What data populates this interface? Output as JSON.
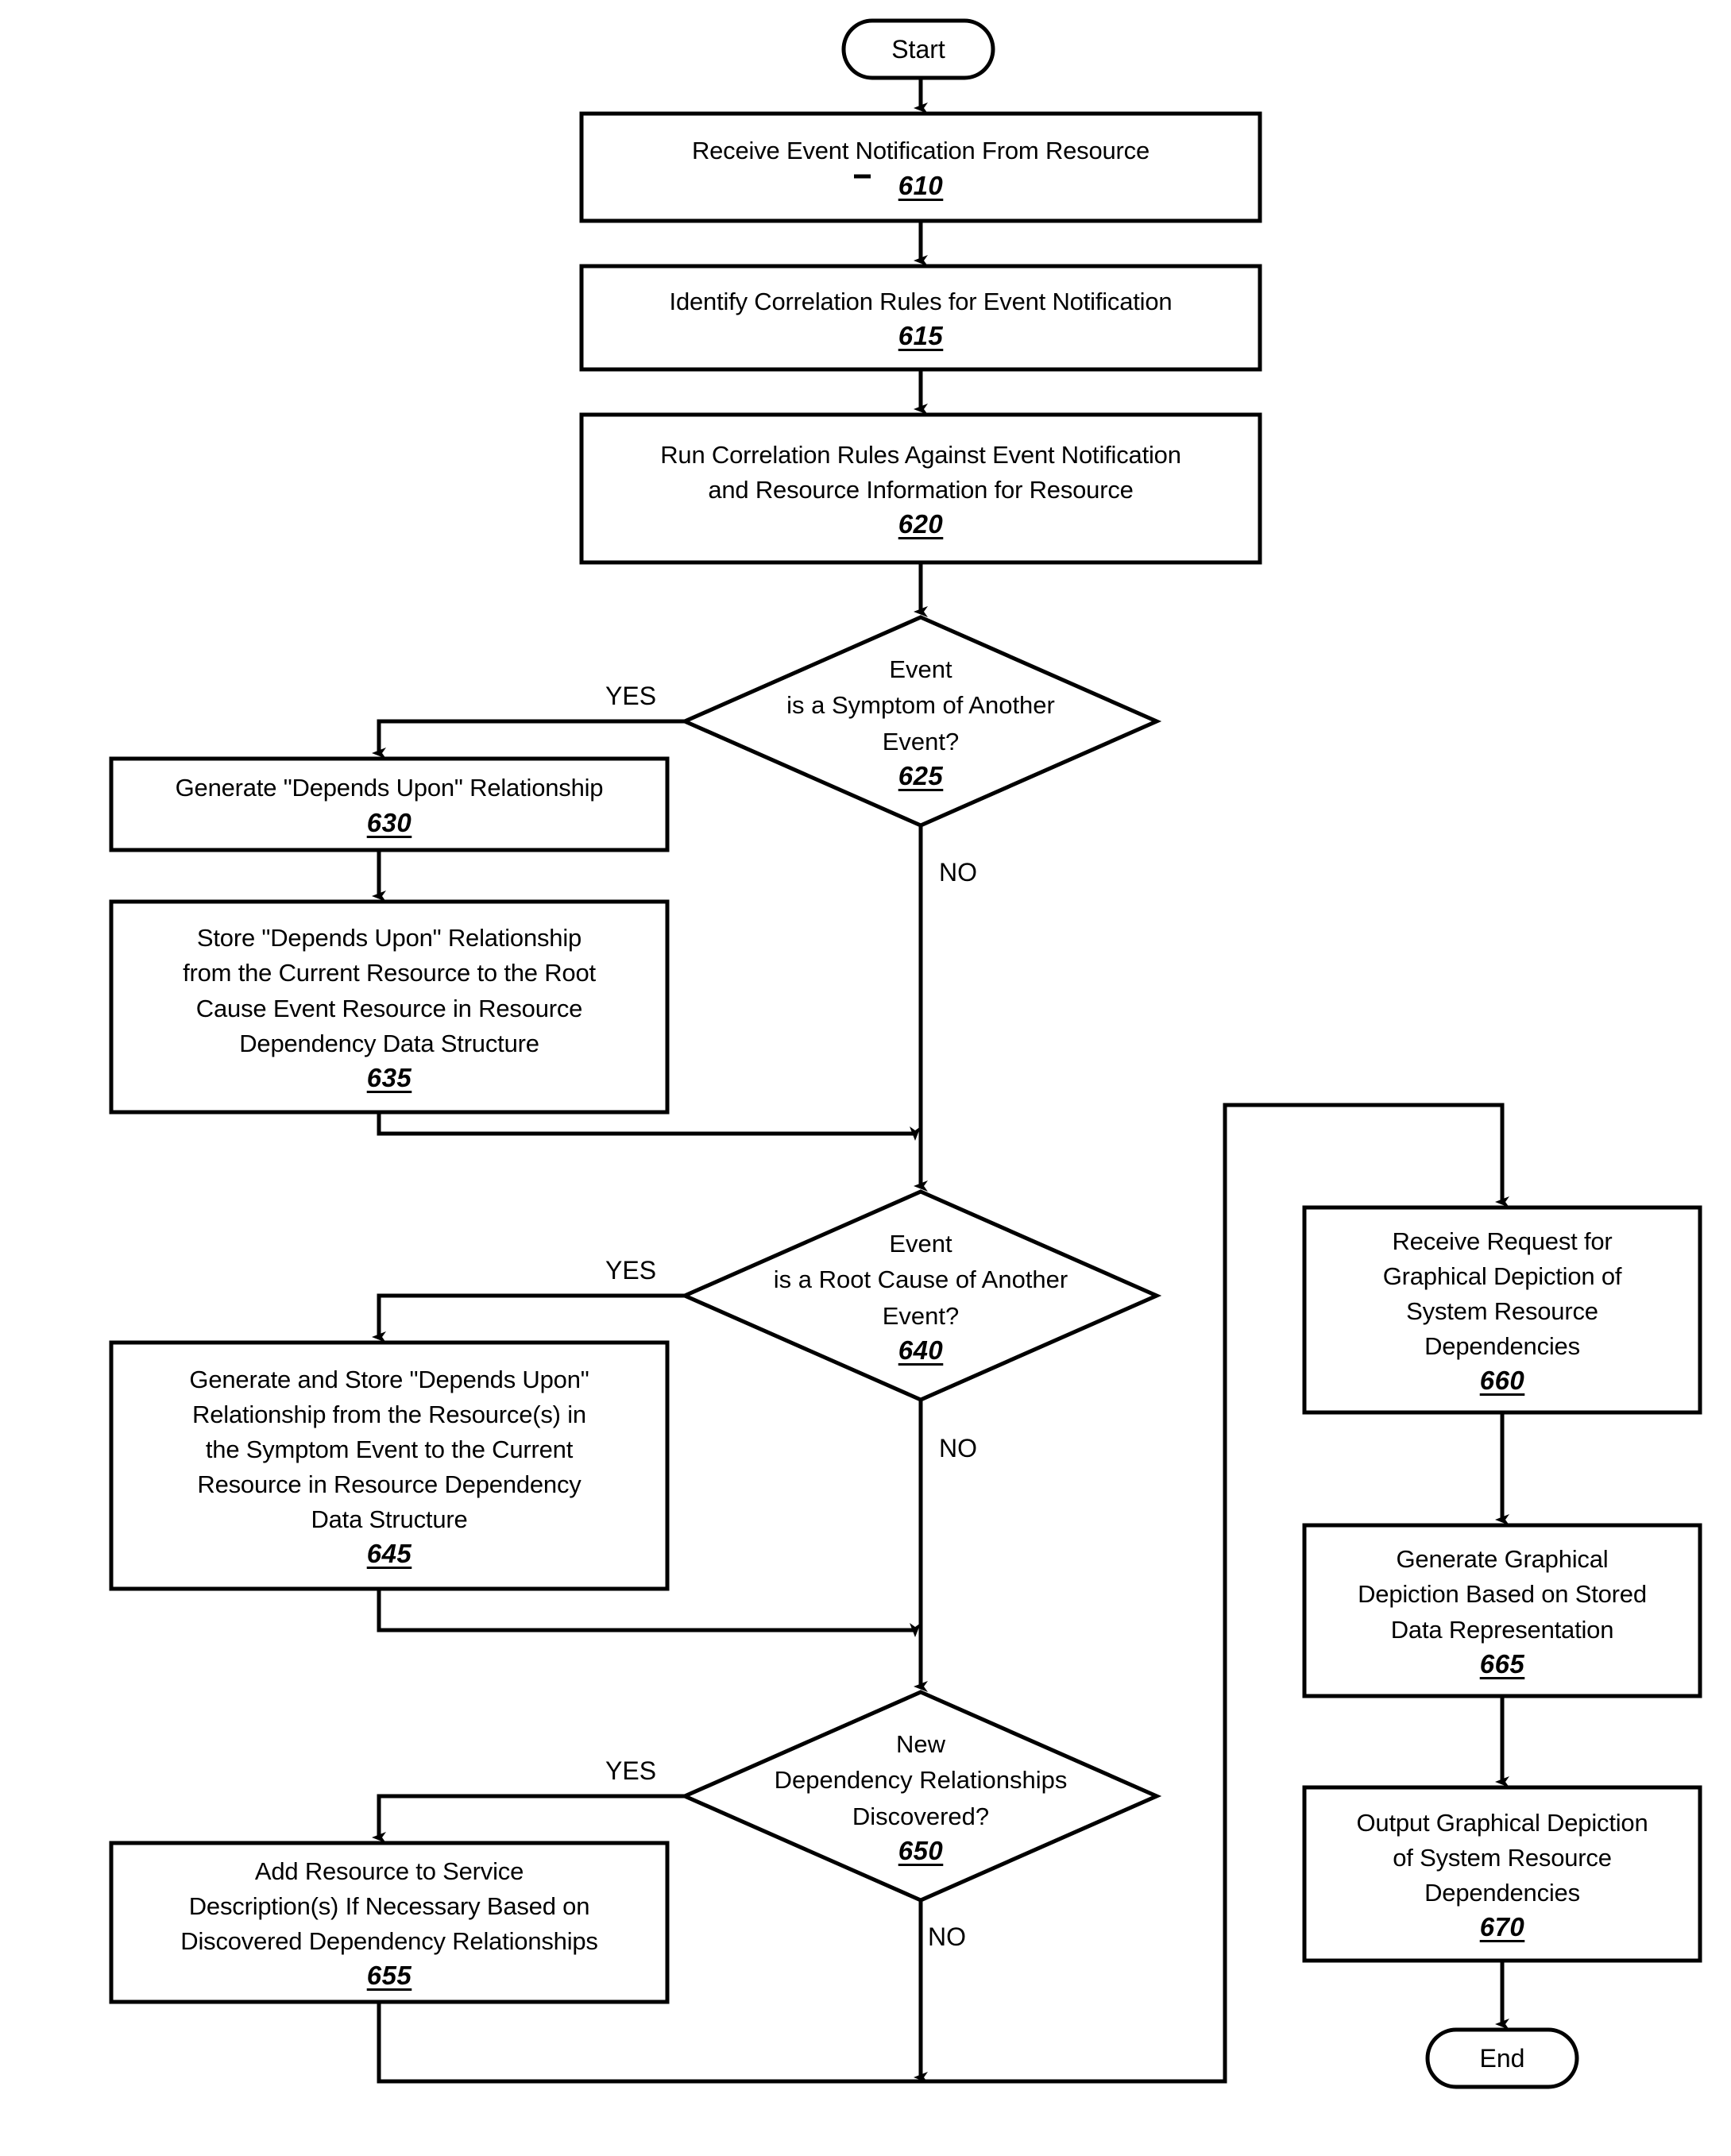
{
  "diagram": {
    "type": "flowchart",
    "orientation": "top-to-bottom",
    "terminators": {
      "start": "Start",
      "end": "End"
    },
    "branch_labels": {
      "yes": "YES",
      "no": "NO"
    },
    "nodes": [
      {
        "id": "start",
        "shape": "terminator",
        "text": "Start"
      },
      {
        "id": "n610",
        "shape": "process",
        "text": "Receive Event Notification From Resource",
        "ref": "610"
      },
      {
        "id": "n615",
        "shape": "process",
        "text": "Identify Correlation Rules for Event Notification",
        "ref": "615"
      },
      {
        "id": "n620",
        "shape": "process",
        "text": "Run Correlation Rules Against Event Notification\nand Resource Information for Resource",
        "ref": "620"
      },
      {
        "id": "n625",
        "shape": "decision",
        "text": "Event\nis a Symptom of Another\nEvent?",
        "ref": "625"
      },
      {
        "id": "n630",
        "shape": "process",
        "text": "Generate \"Depends Upon\" Relationship",
        "ref": "630"
      },
      {
        "id": "n635",
        "shape": "process",
        "text": "Store \"Depends Upon\" Relationship\nfrom the Current Resource to the Root\nCause Event Resource in Resource\nDependency Data Structure",
        "ref": "635"
      },
      {
        "id": "n640",
        "shape": "decision",
        "text": "Event\nis a Root Cause of Another\nEvent?",
        "ref": "640"
      },
      {
        "id": "n645",
        "shape": "process",
        "text": "Generate and Store \"Depends Upon\"\nRelationship from the Resource(s) in\nthe Symptom Event to the Current\nResource in Resource Dependency\nData Structure",
        "ref": "645"
      },
      {
        "id": "n650",
        "shape": "decision",
        "text": "New\nDependency Relationships\nDiscovered?",
        "ref": "650"
      },
      {
        "id": "n655",
        "shape": "process",
        "text": "Add Resource to Service\nDescription(s) If Necessary Based on\nDiscovered Dependency Relationships",
        "ref": "655"
      },
      {
        "id": "n660",
        "shape": "process",
        "text": "Receive Request for\nGraphical Depiction of\nSystem Resource\nDependencies",
        "ref": "660"
      },
      {
        "id": "n665",
        "shape": "process",
        "text": "Generate Graphical\nDepiction Based on Stored\nData Representation",
        "ref": "665"
      },
      {
        "id": "n670",
        "shape": "process",
        "text": "Output Graphical Depiction\nof System Resource\nDependencies",
        "ref": "670"
      },
      {
        "id": "end",
        "shape": "terminator",
        "text": "End"
      }
    ],
    "edge_labels": {
      "yes_625": "YES",
      "no_625": "NO",
      "yes_640": "YES",
      "no_640": "NO",
      "yes_650": "YES",
      "no_650": "NO"
    },
    "colors": {
      "stroke": "#000000",
      "fill": "#ffffff",
      "text": "#000000"
    }
  }
}
